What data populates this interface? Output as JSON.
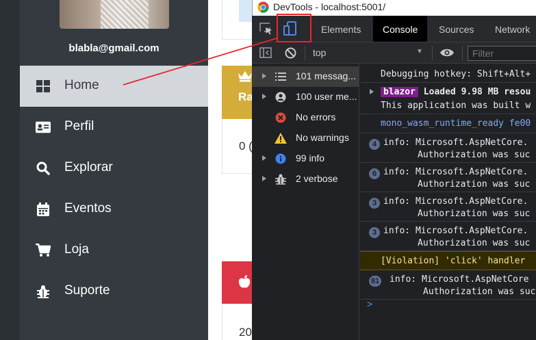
{
  "sidebar": {
    "email": "blabla@gmail.com",
    "items": [
      {
        "label": "Home",
        "icon": "grid-icon",
        "active": true
      },
      {
        "label": "Perfil",
        "icon": "id-card-icon",
        "active": false
      },
      {
        "label": "Explorar",
        "icon": "search-icon",
        "active": false
      },
      {
        "label": "Eventos",
        "icon": "calendar-icon",
        "active": false
      },
      {
        "label": "Loja",
        "icon": "cart-icon",
        "active": false
      },
      {
        "label": "Suporte",
        "icon": "bug-icon",
        "active": false
      }
    ]
  },
  "page": {
    "gold_card_text": "Ra",
    "white_card_value": "0 (",
    "bottom_value": "20"
  },
  "devtools": {
    "window_title": "DevTools - localhost:5001/",
    "tabs": [
      {
        "label": "Elements",
        "active": false
      },
      {
        "label": "Console",
        "active": true
      },
      {
        "label": "Sources",
        "active": false
      },
      {
        "label": "Network",
        "active": false
      }
    ],
    "context": "top",
    "filter_placeholder": "Filter",
    "sidebar": [
      {
        "label": "101 messag...",
        "icon": "list-icon",
        "expandable": true,
        "selected": true
      },
      {
        "label": "100 user me...",
        "icon": "user-icon",
        "expandable": true,
        "selected": false
      },
      {
        "label": "No errors",
        "icon": "error-icon",
        "expandable": false,
        "selected": false
      },
      {
        "label": "No warnings",
        "icon": "warning-icon",
        "expandable": false,
        "selected": false
      },
      {
        "label": "99 info",
        "icon": "info-icon",
        "expandable": true,
        "selected": false
      },
      {
        "label": "2 verbose",
        "icon": "bug-icon",
        "expandable": true,
        "selected": false
      }
    ],
    "messages": [
      {
        "line1": "Debugging hotkey: Shift+Alt+",
        "line2": ""
      },
      {
        "badge": "blazor",
        "line1": " Loaded 9.98 MB resou",
        "line2": "This application was built w"
      },
      {
        "line1": "mono_wasm_runtime_ready fe00",
        "line2": ""
      },
      {
        "count": "4",
        "line1": "info: Microsoft.AspNetCore.",
        "line2": "Authorization was suc"
      },
      {
        "count": "6",
        "line1": "info: Microsoft.AspNetCore.",
        "line2": "Authorization was suc"
      },
      {
        "count": "3",
        "line1": "info: Microsoft.AspNetCore.",
        "line2": "Authorization was suc"
      },
      {
        "count": "3",
        "line1": "info: Microsoft.AspNetCore.",
        "line2": "Authorization was suc"
      },
      {
        "line1": "[Violation] 'click' handler",
        "line2": ""
      },
      {
        "count": "81",
        "line1": "info: Microsoft.AspNetCore",
        "line2": "Authorization was suc"
      }
    ],
    "prompt": ">"
  },
  "colors": {
    "sidebar_bg": "#343a40",
    "active_item_bg": "#d3d7dc",
    "devtools_bg": "#202124",
    "annotation_red": "#e8262e",
    "gold": "#d4ac3a",
    "red_card": "#dc3545"
  }
}
